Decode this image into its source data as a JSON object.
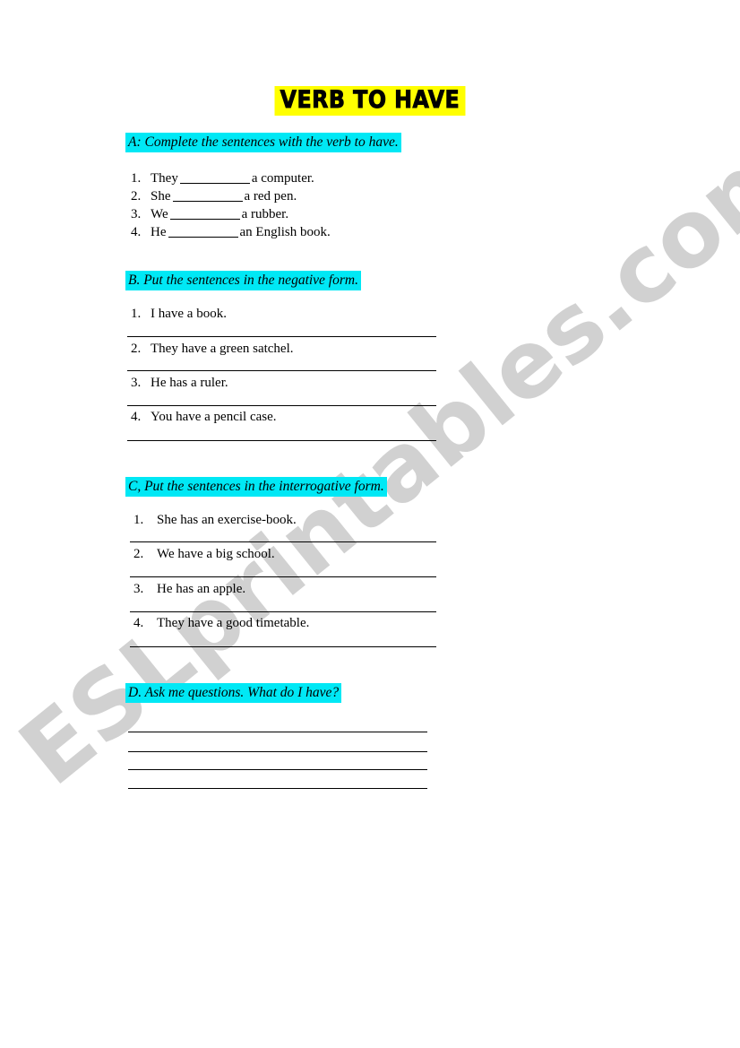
{
  "document": {
    "title": "VERB TO HAVE",
    "watermark": "ESLprintables.com",
    "highlight_title_color": "#ffff00",
    "highlight_section_color": "#00e8f5"
  },
  "sections": [
    {
      "id": "A",
      "heading": "A:  Complete the sentences with the verb to have.",
      "type": "fill-in-blank",
      "items": [
        {
          "num": "1.",
          "before": "They",
          "after": "a computer."
        },
        {
          "num": "2.",
          "before": "She",
          "after": "a red pen."
        },
        {
          "num": "3.",
          "before": "We",
          "after": "a rubber."
        },
        {
          "num": "4.",
          "before": "He",
          "after": "an English book."
        }
      ]
    },
    {
      "id": "B",
      "heading": "B. Put the sentences in the negative form.",
      "type": "rewrite",
      "items": [
        {
          "num": "1.",
          "text": "I have a book."
        },
        {
          "num": "2.",
          "text": "They have a green satchel."
        },
        {
          "num": "3.",
          "text": "He has a ruler."
        },
        {
          "num": "4.",
          "text": "You have a pencil case."
        }
      ]
    },
    {
      "id": "C",
      "heading": "C,  Put the sentences in the interrogative form.",
      "type": "rewrite",
      "items": [
        {
          "num": "1.",
          "text": "She has an exercise-book."
        },
        {
          "num": "2.",
          "text": "We have a big school."
        },
        {
          "num": "3.",
          "text": "He has an apple."
        },
        {
          "num": "4.",
          "text": "They have a good timetable."
        }
      ]
    },
    {
      "id": "D",
      "heading": "D. Ask me questions. What do I have?",
      "type": "free-response",
      "blank_line_count": 4
    }
  ]
}
